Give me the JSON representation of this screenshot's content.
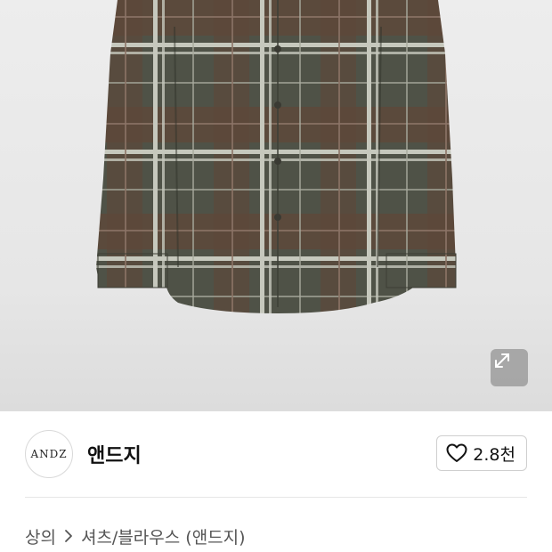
{
  "product_image": {
    "subject": "plaid shirt",
    "colors": {
      "base": "#5a5a4f",
      "brown": "#6b4a3c",
      "light": "#c9cac0",
      "background": "#ebebeb"
    },
    "expand_icon": "expand-icon"
  },
  "brand": {
    "logo_text": "ANDZ",
    "name": "앤드지",
    "like_icon": "heart-icon",
    "like_count": "2.8천"
  },
  "breadcrumb": {
    "items": [
      "상의",
      "셔츠/블라우스 (앤드지)"
    ],
    "separator_icon": "chevron-right-icon"
  }
}
